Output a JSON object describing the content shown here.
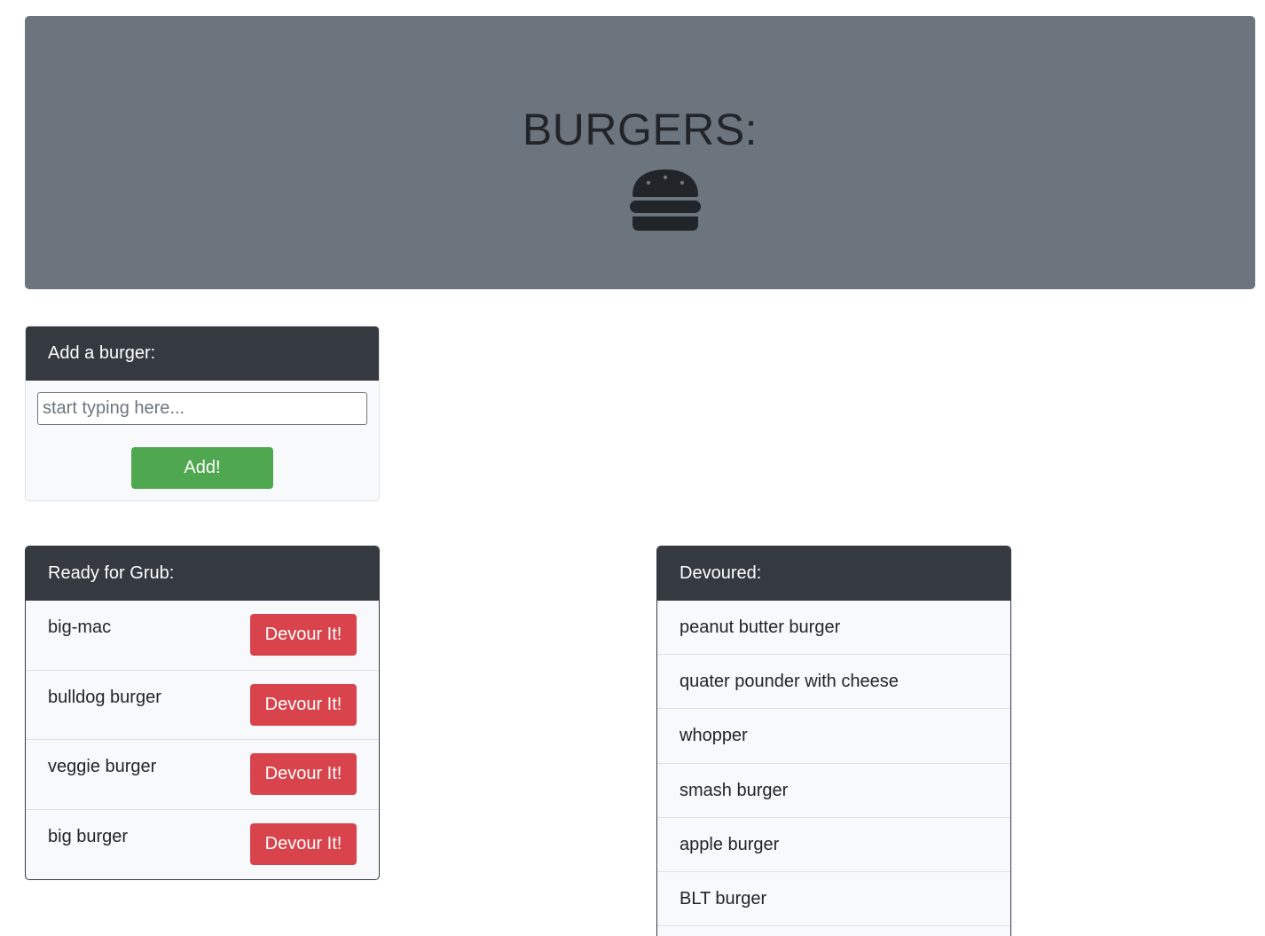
{
  "header": {
    "title": "BURGERS:",
    "icon": "hamburger-icon"
  },
  "add_form": {
    "title": "Add a burger:",
    "input_placeholder": "start typing here...",
    "input_value": "",
    "submit_label": "Add!"
  },
  "ready": {
    "title": "Ready for Grub:",
    "button_label": "Devour It!",
    "items": [
      {
        "name": "big-mac"
      },
      {
        "name": "bulldog burger"
      },
      {
        "name": "veggie burger"
      },
      {
        "name": "big burger"
      }
    ]
  },
  "devoured": {
    "title": "Devoured:",
    "items": [
      {
        "name": "peanut butter burger"
      },
      {
        "name": "quater pounder with cheese"
      },
      {
        "name": "whopper"
      },
      {
        "name": "smash burger"
      },
      {
        "name": "apple burger"
      },
      {
        "name": "BLT burger"
      }
    ]
  },
  "colors": {
    "jumbotron": "#6c757d",
    "card_header": "#343a40",
    "add_button": "#4fa84f",
    "devour_button": "#d9444c"
  }
}
